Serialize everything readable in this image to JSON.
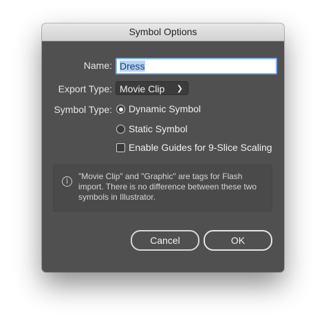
{
  "window": {
    "title": "Symbol Options"
  },
  "form": {
    "name_label": "Name:",
    "name_value": "Dress",
    "export_type_label": "Export Type:",
    "export_type_value": "Movie Clip",
    "symbol_type_label": "Symbol Type:",
    "symbol_type_options": [
      {
        "label": "Dynamic Symbol",
        "selected": true
      },
      {
        "label": "Static Symbol",
        "selected": false
      }
    ],
    "guides_label": "Enable Guides for 9-Slice Scaling",
    "guides_checked": false
  },
  "info": {
    "icon": "info-icon",
    "text": "\"Movie Clip\" and \"Graphic\" are tags for Flash import. There is no difference between these two symbols in Illustrator."
  },
  "buttons": {
    "cancel_label": "Cancel",
    "ok_label": "OK"
  }
}
